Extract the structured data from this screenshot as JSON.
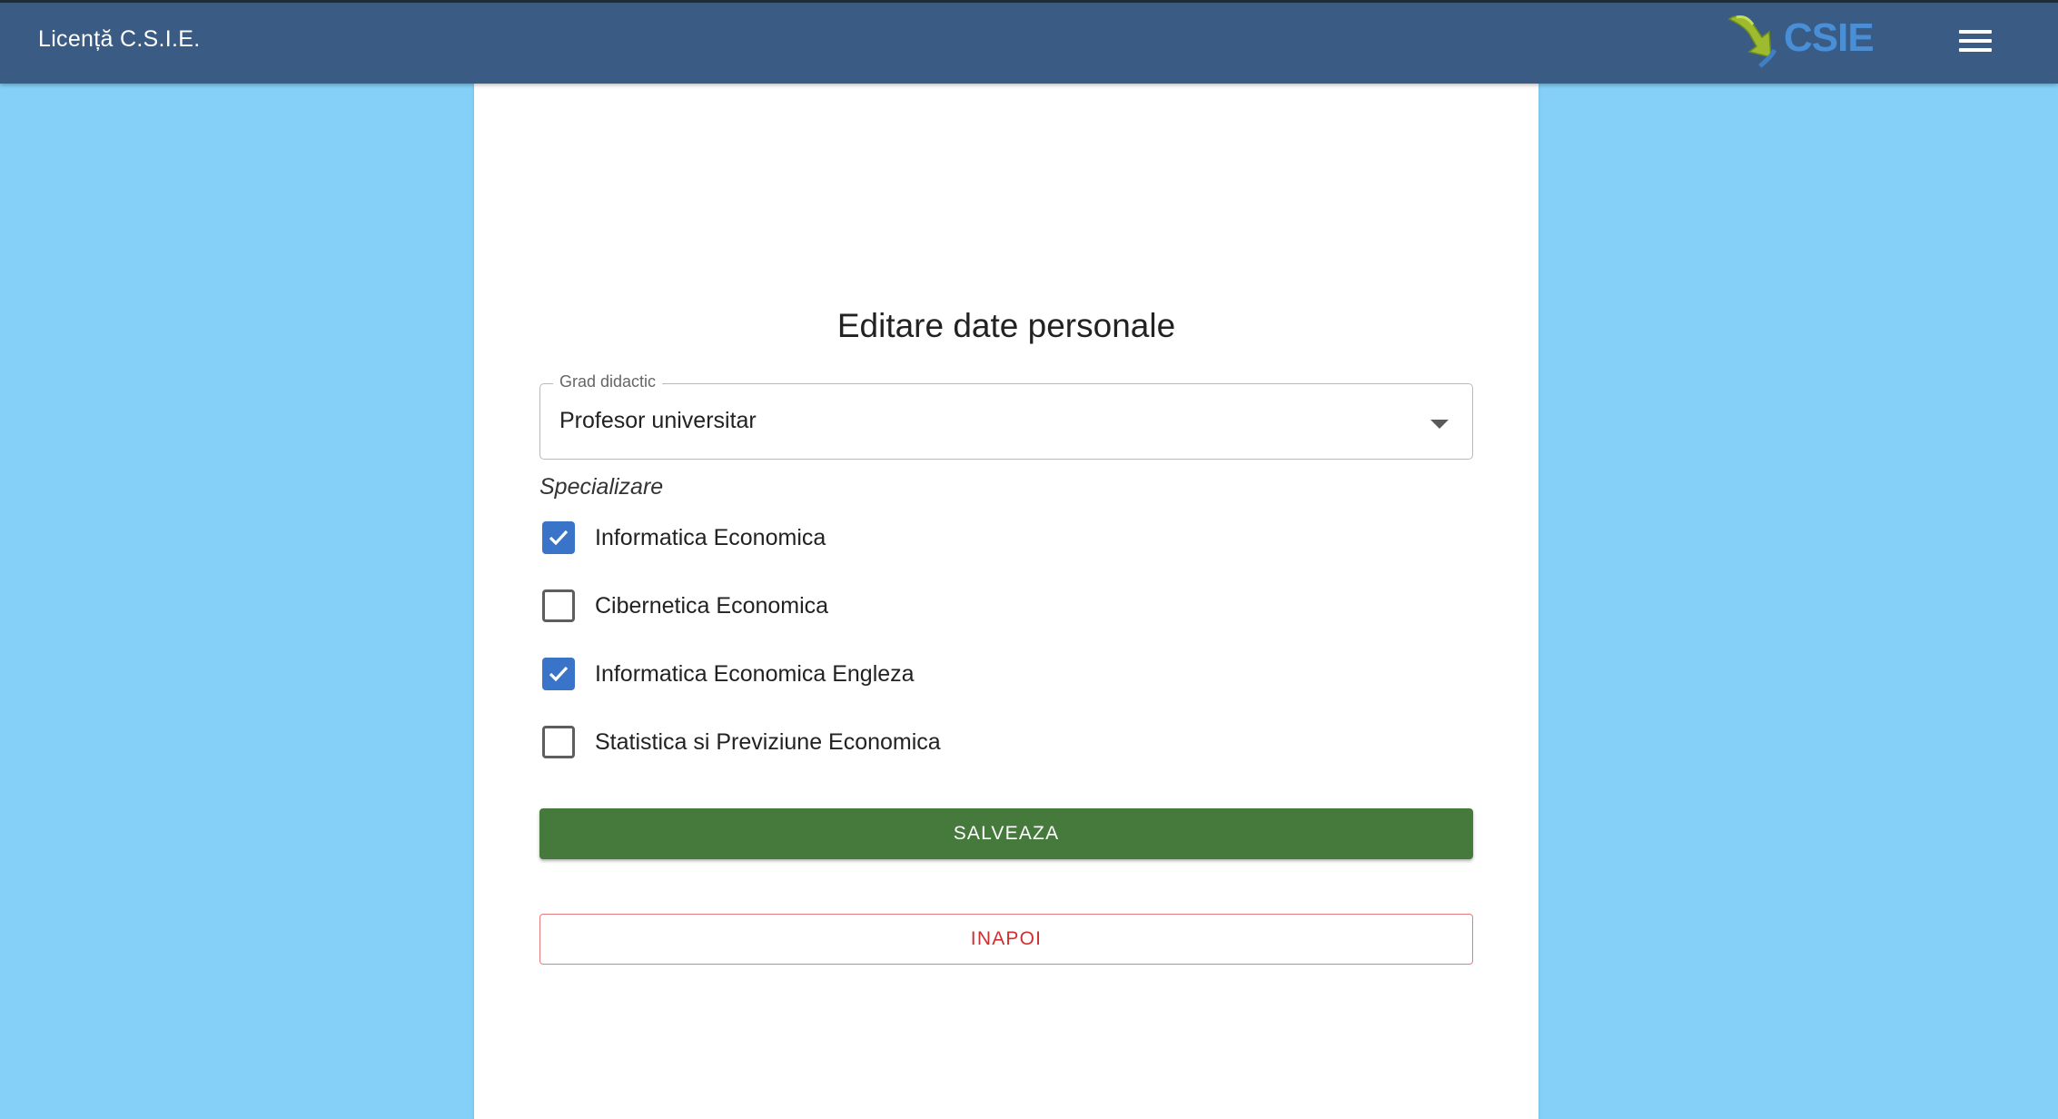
{
  "header": {
    "title": "Licență C.S.I.E.",
    "logo_text": "CSIE",
    "logo_icon": "csie-logo-arrow",
    "menu_icon": "hamburger-menu-icon"
  },
  "form": {
    "title": "Editare date personale",
    "grad": {
      "label": "Grad didactic",
      "value": "Profesor universitar"
    },
    "specializare": {
      "label": "Specializare",
      "options": [
        {
          "label": "Informatica Economica",
          "checked": true
        },
        {
          "label": "Cibernetica Economica",
          "checked": false
        },
        {
          "label": "Informatica Economica Engleza",
          "checked": true
        },
        {
          "label": "Statistica si Previziune Economica",
          "checked": false
        }
      ]
    },
    "save_label": "SALVEAZA",
    "back_label": "INAPOI"
  },
  "colors": {
    "header_bg": "#3a5b84",
    "page_bg": "#85d0f8",
    "checkbox_checked": "#3a74c9",
    "save_button": "#457a3c",
    "back_button_text": "#d12f2f"
  }
}
